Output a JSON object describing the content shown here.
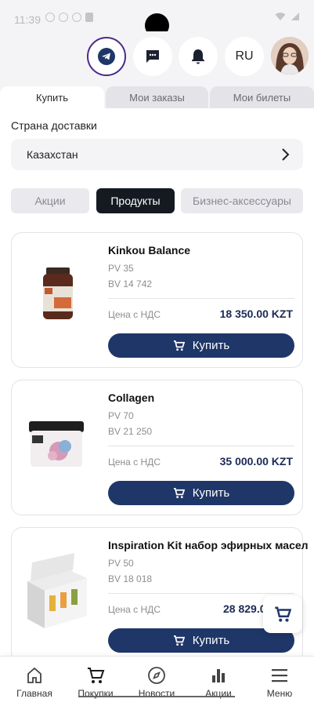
{
  "status_bar": {
    "time": "11:39"
  },
  "header": {
    "lang": "RU",
    "icons": [
      "telegram-icon",
      "chat-icon",
      "bell-icon"
    ]
  },
  "tabs": [
    {
      "label": "Купить",
      "active": true
    },
    {
      "label": "Мои заказы",
      "active": false
    },
    {
      "label": "Мои билеты",
      "active": false
    }
  ],
  "delivery": {
    "label": "Страна доставки",
    "country": "Казахстан"
  },
  "filters": [
    {
      "label": "Акции",
      "active": false
    },
    {
      "label": "Продукты",
      "active": true
    },
    {
      "label": "Бизнес-аксессуары",
      "active": false
    }
  ],
  "products": [
    {
      "name": "Kinkou Balance",
      "pv": "PV 35",
      "bv": "BV 14 742",
      "price_label": "Цена с НДС",
      "price": "18 350.00 KZT",
      "buy_label": "Купить"
    },
    {
      "name": "Collagen",
      "pv": "PV 70",
      "bv": "BV 21 250",
      "price_label": "Цена с НДС",
      "price": "35 000.00 KZT",
      "buy_label": "Купить"
    },
    {
      "name": "Inspiration Kit набор эфирных масел",
      "pv": "PV 50",
      "bv": "BV 18 018",
      "price_label": "Цена с НДС",
      "price": "28 829.0",
      "buy_label": "Купить"
    }
  ],
  "bottom_nav": [
    {
      "label": "Главная",
      "icon": "home-icon"
    },
    {
      "label": "Покупки",
      "icon": "cart-icon"
    },
    {
      "label": "Новости",
      "icon": "compass-icon"
    },
    {
      "label": "Акции",
      "icon": "bar-chart-icon"
    },
    {
      "label": "Меню",
      "icon": "menu-icon"
    }
  ],
  "colors": {
    "primary": "#1f3668",
    "filter_active": "#151a22",
    "background_gray": "#f4f4f6"
  }
}
